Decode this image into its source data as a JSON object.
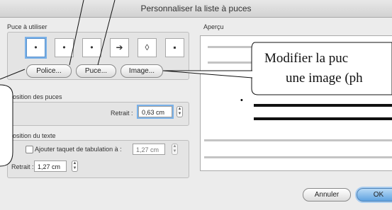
{
  "window": {
    "title": "Personnaliser la liste à puces"
  },
  "bullets_section": {
    "label": "Puce à utiliser",
    "bullets": [
      "•",
      "•",
      "•",
      "➔",
      "◊",
      "▪"
    ],
    "selected_index": 0
  },
  "buttons": {
    "police": "Police...",
    "puce": "Puce...",
    "image": "Image..."
  },
  "bullet_position": {
    "label": "Position des puces",
    "indent_label": "Retrait :",
    "indent_value": "0,63 cm"
  },
  "text_position": {
    "label": "Position du texte",
    "tab_checkbox_label": "Ajouter taquet de tabulation à :",
    "tab_checked": false,
    "tab_value": "1,27 cm",
    "indent_label": "Retrait :",
    "indent_value": "1,27 cm"
  },
  "preview": {
    "label": "Aperçu",
    "bullet_glyph": "•"
  },
  "footer": {
    "cancel": "Annuler",
    "ok": "OK"
  },
  "callout": {
    "line1": "Modifier la puc",
    "line2": "une image (ph"
  },
  "colors": {
    "ok_button": "#7fb6e8",
    "selection": "#7ab1e8"
  }
}
